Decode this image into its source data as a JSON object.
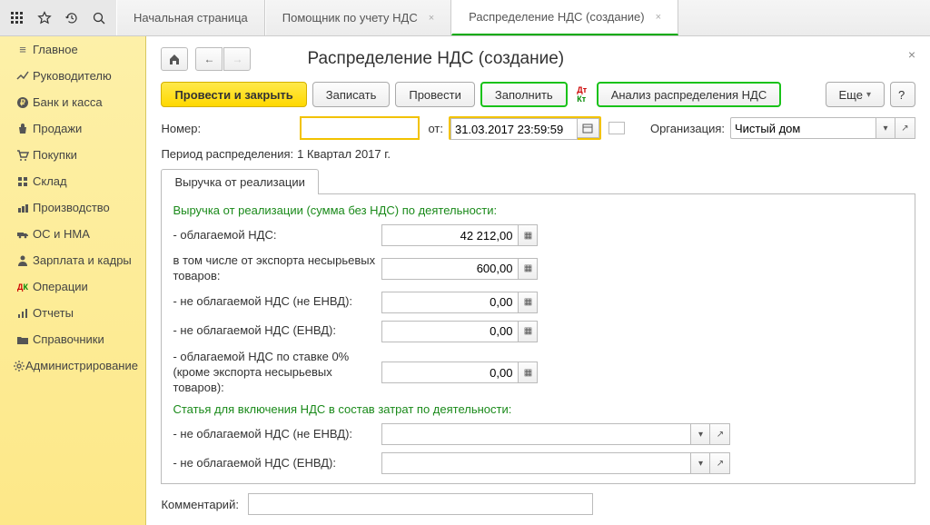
{
  "tabs": {
    "home": "Начальная страница",
    "helper": "Помощник по учету НДС",
    "active": "Распределение НДС (создание)"
  },
  "sidebar": {
    "items": [
      {
        "label": "Главное"
      },
      {
        "label": "Руководителю"
      },
      {
        "label": "Банк и касса"
      },
      {
        "label": "Продажи"
      },
      {
        "label": "Покупки"
      },
      {
        "label": "Склад"
      },
      {
        "label": "Производство"
      },
      {
        "label": "ОС и НМА"
      },
      {
        "label": "Зарплата и кадры"
      },
      {
        "label": "Операции"
      },
      {
        "label": "Отчеты"
      },
      {
        "label": "Справочники"
      },
      {
        "label": "Администрирование"
      }
    ]
  },
  "page": {
    "title": "Распределение НДС (создание)"
  },
  "toolbar": {
    "post_and_close": "Провести и закрыть",
    "save": "Записать",
    "post": "Провести",
    "fill": "Заполнить",
    "analysis": "Анализ распределения НДС",
    "more": "Еще",
    "help": "?"
  },
  "form": {
    "number_label": "Номер:",
    "number_value": "",
    "from_label": "от:",
    "date_value": "31.03.2017 23:59:59",
    "org_label": "Организация:",
    "org_value": "Чистый дом",
    "period_label": "Период распределения:",
    "period_value": "1 Квартал 2017  г.",
    "comment_label": "Комментарий:",
    "comment_value": ""
  },
  "tab1": {
    "title": "Выручка от реализации",
    "section1": "Выручка от реализации (сумма без НДС) по деятельности:",
    "row1_label": "- облагаемой НДС:",
    "row1_value": "42 212,00",
    "row2_label": "в том числе от экспорта несырьевых товаров:",
    "row2_value": "600,00",
    "row3_label": "- не облагаемой НДС (не ЕНВД):",
    "row3_value": "0,00",
    "row4_label": "- не облагаемой НДС (ЕНВД):",
    "row4_value": "0,00",
    "row5_label": "- облагаемой НДС по ставке 0% (кроме экспорта несырьевых товаров):",
    "row5_value": "0,00",
    "section2": "Статья для включения НДС в состав затрат по деятельности:",
    "row6_label": "- не облагаемой НДС (не ЕНВД):",
    "row6_value": "",
    "row7_label": "- не облагаемой НДС (ЕНВД):",
    "row7_value": ""
  }
}
